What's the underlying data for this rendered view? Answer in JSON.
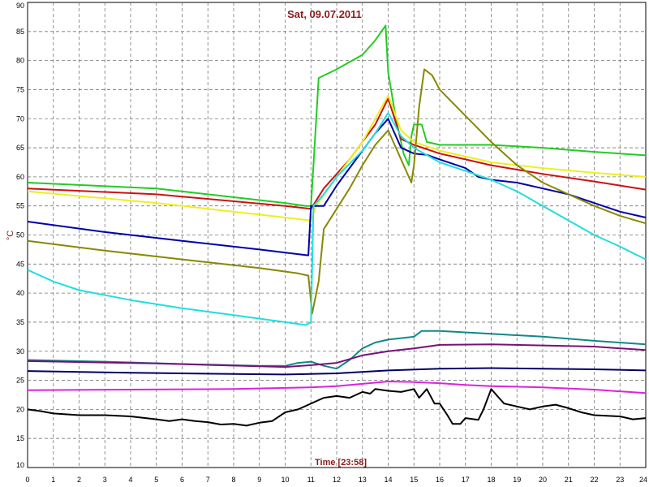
{
  "chart_data": {
    "type": "line",
    "title": "Sat, 09.07.2011",
    "xlabel": "Time [23:58]",
    "ylabel": "°C",
    "xlim": [
      0,
      24
    ],
    "ylim": [
      10,
      90
    ],
    "x_ticks": [
      "0",
      "1",
      "2",
      "3",
      "4",
      "5",
      "6",
      "7",
      "8",
      "9",
      "10",
      "11",
      "12",
      "13",
      "14",
      "15",
      "16",
      "17",
      "18",
      "19",
      "20",
      "21",
      "22",
      "23",
      "24"
    ],
    "y_ticks": [
      "10",
      "15",
      "20",
      "25",
      "30",
      "35",
      "40",
      "45",
      "50",
      "55",
      "60",
      "65",
      "70",
      "75",
      "80",
      "85",
      "90"
    ],
    "grid": true,
    "series": [
      {
        "color": "#22cc22",
        "points": [
          [
            0,
            59
          ],
          [
            5,
            58
          ],
          [
            10,
            55.5
          ],
          [
            10.8,
            55
          ],
          [
            11,
            55
          ],
          [
            11.1,
            62
          ],
          [
            11.3,
            77
          ],
          [
            12,
            78.5
          ],
          [
            13,
            81
          ],
          [
            13.5,
            83.5
          ],
          [
            13.9,
            86
          ],
          [
            14,
            78
          ],
          [
            14.3,
            70
          ],
          [
            14.6,
            64
          ],
          [
            14.8,
            62
          ],
          [
            14.9,
            67
          ],
          [
            15,
            69
          ],
          [
            15.3,
            69
          ],
          [
            15.5,
            66
          ],
          [
            16,
            65.5
          ],
          [
            18,
            65.5
          ],
          [
            20,
            65
          ],
          [
            22,
            64.3
          ],
          [
            24,
            63.7
          ]
        ]
      },
      {
        "color": "#cc1111",
        "points": [
          [
            0,
            58
          ],
          [
            5,
            57
          ],
          [
            10,
            55
          ],
          [
            11,
            54.5
          ],
          [
            11.5,
            58
          ],
          [
            12.5,
            63
          ],
          [
            13.5,
            69
          ],
          [
            14,
            73.5
          ],
          [
            14.5,
            66.5
          ],
          [
            15,
            65.5
          ],
          [
            16,
            64
          ],
          [
            17,
            63
          ],
          [
            18,
            62
          ],
          [
            20,
            60.5
          ],
          [
            22,
            59.2
          ],
          [
            24,
            57.8
          ]
        ]
      },
      {
        "color": "#eeee22",
        "points": [
          [
            0,
            57.5
          ],
          [
            5,
            55.5
          ],
          [
            10,
            53
          ],
          [
            11,
            52.5
          ],
          [
            11.2,
            55
          ],
          [
            12,
            60
          ],
          [
            13,
            66
          ],
          [
            13.5,
            70
          ],
          [
            14,
            74
          ],
          [
            14.5,
            68
          ],
          [
            15,
            66
          ],
          [
            16,
            64.5
          ],
          [
            18,
            62.5
          ],
          [
            20,
            61.5
          ],
          [
            22,
            60.7
          ],
          [
            24,
            60
          ]
        ]
      },
      {
        "color": "#0000aa",
        "points": [
          [
            0,
            52.3
          ],
          [
            3,
            50.5
          ],
          [
            6,
            49
          ],
          [
            9,
            47.5
          ],
          [
            10.5,
            46.7
          ],
          [
            10.9,
            46.5
          ],
          [
            11,
            55
          ],
          [
            11.5,
            55
          ],
          [
            12,
            58.5
          ],
          [
            13,
            64.5
          ],
          [
            13.5,
            67.5
          ],
          [
            14,
            70
          ],
          [
            14.5,
            65
          ],
          [
            15,
            64
          ],
          [
            15.5,
            63.8
          ],
          [
            16,
            63
          ],
          [
            17,
            61.5
          ],
          [
            17.5,
            60
          ],
          [
            18,
            59.5
          ],
          [
            19,
            59
          ],
          [
            20,
            58
          ],
          [
            21,
            57
          ],
          [
            22,
            55.5
          ],
          [
            23,
            54
          ],
          [
            24,
            53
          ]
        ]
      },
      {
        "color": "#888800",
        "points": [
          [
            0,
            49
          ],
          [
            3,
            47.3
          ],
          [
            6,
            45.8
          ],
          [
            9,
            44.3
          ],
          [
            10.5,
            43.4
          ],
          [
            10.9,
            43
          ],
          [
            11.05,
            36.5
          ],
          [
            11.3,
            42
          ],
          [
            11.5,
            51
          ],
          [
            12,
            54.5
          ],
          [
            12.5,
            58
          ],
          [
            13,
            62
          ],
          [
            13.5,
            65.5
          ],
          [
            14,
            68
          ],
          [
            14.5,
            63
          ],
          [
            14.9,
            59
          ],
          [
            15,
            62
          ],
          [
            15.2,
            72
          ],
          [
            15.4,
            78.5
          ],
          [
            15.7,
            77.5
          ],
          [
            16,
            75
          ],
          [
            17,
            70.5
          ],
          [
            18,
            66
          ],
          [
            18.5,
            64
          ],
          [
            19,
            62
          ],
          [
            20,
            59
          ],
          [
            21,
            57
          ],
          [
            22,
            55
          ],
          [
            23,
            53.3
          ],
          [
            24,
            52
          ]
        ]
      },
      {
        "color": "#22dddd",
        "points": [
          [
            0,
            44
          ],
          [
            1,
            42
          ],
          [
            2,
            40.5
          ],
          [
            4,
            38.8
          ],
          [
            6,
            37.4
          ],
          [
            8,
            36.2
          ],
          [
            10,
            35
          ],
          [
            10.8,
            34.5
          ],
          [
            11,
            35
          ],
          [
            11.1,
            55
          ],
          [
            11.5,
            57
          ],
          [
            12,
            60
          ],
          [
            13,
            64.5
          ],
          [
            13.5,
            67.5
          ],
          [
            14,
            71
          ],
          [
            14.5,
            67
          ],
          [
            15,
            65
          ],
          [
            16,
            62.5
          ],
          [
            17,
            61
          ],
          [
            18,
            59.5
          ],
          [
            19,
            57.5
          ],
          [
            20,
            55
          ],
          [
            21,
            52.5
          ],
          [
            22,
            50
          ],
          [
            23,
            48
          ],
          [
            24,
            45.8
          ]
        ]
      },
      {
        "color": "#118888",
        "points": [
          [
            0,
            28.5
          ],
          [
            3,
            28.2
          ],
          [
            6,
            27.8
          ],
          [
            9,
            27.5
          ],
          [
            10,
            27.5
          ],
          [
            10.5,
            28
          ],
          [
            11,
            28.2
          ],
          [
            11.5,
            27.5
          ],
          [
            12,
            27
          ],
          [
            12.5,
            28.5
          ],
          [
            13,
            30.5
          ],
          [
            13.5,
            31.5
          ],
          [
            14,
            32
          ],
          [
            15,
            32.5
          ],
          [
            15.3,
            33.5
          ],
          [
            16,
            33.5
          ],
          [
            18,
            33
          ],
          [
            20,
            32.5
          ],
          [
            22,
            31.8
          ],
          [
            24,
            31.2
          ]
        ]
      },
      {
        "color": "#771177",
        "points": [
          [
            0,
            28.3
          ],
          [
            5,
            27.9
          ],
          [
            10,
            27.3
          ],
          [
            11,
            27.6
          ],
          [
            12,
            28
          ],
          [
            13,
            29.3
          ],
          [
            14,
            30
          ],
          [
            15,
            30.5
          ],
          [
            16,
            31.1
          ],
          [
            18,
            31.2
          ],
          [
            20,
            31
          ],
          [
            22,
            30.8
          ],
          [
            24,
            30.2
          ]
        ]
      },
      {
        "color": "#000066",
        "points": [
          [
            0,
            26.6
          ],
          [
            4,
            26.3
          ],
          [
            8,
            26.1
          ],
          [
            10,
            26
          ],
          [
            12,
            26.2
          ],
          [
            14,
            26.7
          ],
          [
            16,
            27
          ],
          [
            18,
            27.1
          ],
          [
            20,
            27
          ],
          [
            22,
            26.9
          ],
          [
            24,
            26.7
          ]
        ]
      },
      {
        "color": "#dd22dd",
        "points": [
          [
            0,
            23.3
          ],
          [
            4,
            23.4
          ],
          [
            8,
            23.5
          ],
          [
            11,
            23.8
          ],
          [
            12,
            24
          ],
          [
            13,
            24.4
          ],
          [
            14,
            24.8
          ],
          [
            15,
            24.7
          ],
          [
            16,
            24.5
          ],
          [
            17,
            24.2
          ],
          [
            18,
            24
          ],
          [
            20,
            23.8
          ],
          [
            22,
            23.4
          ],
          [
            24,
            22.8
          ]
        ]
      },
      {
        "color": "#000000",
        "points": [
          [
            0,
            20
          ],
          [
            0.5,
            19.7
          ],
          [
            1,
            19.3
          ],
          [
            2,
            19
          ],
          [
            3,
            19
          ],
          [
            4,
            18.8
          ],
          [
            5,
            18.3
          ],
          [
            5.5,
            18
          ],
          [
            6,
            18.3
          ],
          [
            6.5,
            18
          ],
          [
            7,
            17.8
          ],
          [
            7.5,
            17.4
          ],
          [
            8,
            17.5
          ],
          [
            8.5,
            17.2
          ],
          [
            9,
            17.7
          ],
          [
            9.5,
            18
          ],
          [
            10,
            19.5
          ],
          [
            10.5,
            20
          ],
          [
            11,
            21
          ],
          [
            11.5,
            22
          ],
          [
            12,
            22.3
          ],
          [
            12.5,
            22
          ],
          [
            13,
            23
          ],
          [
            13.3,
            22.7
          ],
          [
            13.5,
            23.5
          ],
          [
            14,
            23.2
          ],
          [
            14.5,
            23
          ],
          [
            15,
            23.5
          ],
          [
            15.2,
            22
          ],
          [
            15.5,
            23.5
          ],
          [
            15.8,
            21
          ],
          [
            16,
            21
          ],
          [
            16.3,
            19
          ],
          [
            16.5,
            17.5
          ],
          [
            16.8,
            17.5
          ],
          [
            17,
            18.5
          ],
          [
            17.5,
            18.2
          ],
          [
            17.7,
            20
          ],
          [
            18,
            23.5
          ],
          [
            18.3,
            22
          ],
          [
            18.5,
            21
          ],
          [
            19,
            20.5
          ],
          [
            19.5,
            20
          ],
          [
            20,
            20.5
          ],
          [
            20.5,
            20.8
          ],
          [
            21,
            20.2
          ],
          [
            21.5,
            19.5
          ],
          [
            22,
            19
          ],
          [
            23,
            18.8
          ],
          [
            23.5,
            18.3
          ],
          [
            24,
            18.5
          ]
        ]
      }
    ]
  }
}
